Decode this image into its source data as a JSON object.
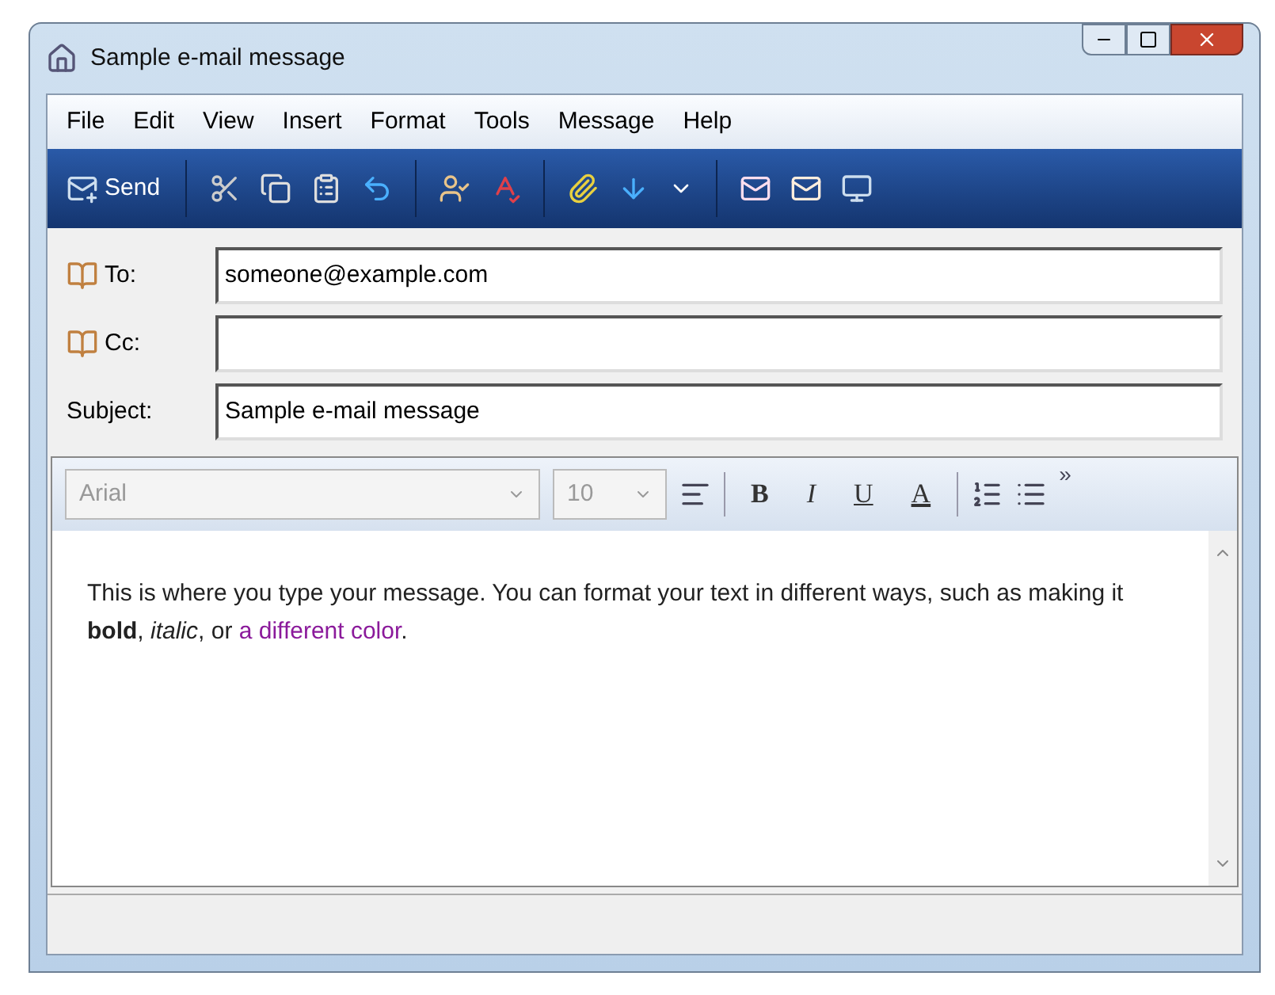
{
  "window": {
    "title": "Sample e-mail message"
  },
  "menu": [
    "File",
    "Edit",
    "View",
    "Insert",
    "Format",
    "Tools",
    "Message",
    "Help"
  ],
  "toolbar": {
    "send": "Send"
  },
  "fields": [
    {
      "label": "To:",
      "kind": "address",
      "value": "someone@example.com"
    },
    {
      "label": "Cc:",
      "kind": "address"
    },
    {
      "label": "Subject:",
      "kind": "plain",
      "value": "Sample e-mail message"
    }
  ],
  "format_bar": {
    "font": "Arial",
    "size": "10",
    "buttons": [
      {
        "label": "B",
        "kind": "bold"
      },
      {
        "label": "I",
        "kind": "italic"
      },
      {
        "label": "U",
        "kind": "underline"
      },
      {
        "label": "A",
        "kind": "color"
      }
    ],
    "more": "»"
  },
  "body": [
    {
      "kind": "plain",
      "text": "This is where you type your message. You can format your text in different ways, such as making it "
    },
    {
      "kind": "bold",
      "text": "bold"
    },
    {
      "kind": "plain",
      "text": ", "
    },
    {
      "kind": "italic",
      "text": "italic"
    },
    {
      "kind": "plain",
      "text": ", or "
    },
    {
      "kind": "colored",
      "text": "a different color",
      "color": "#8b1a9b"
    },
    {
      "kind": "plain",
      "text": "."
    }
  ]
}
